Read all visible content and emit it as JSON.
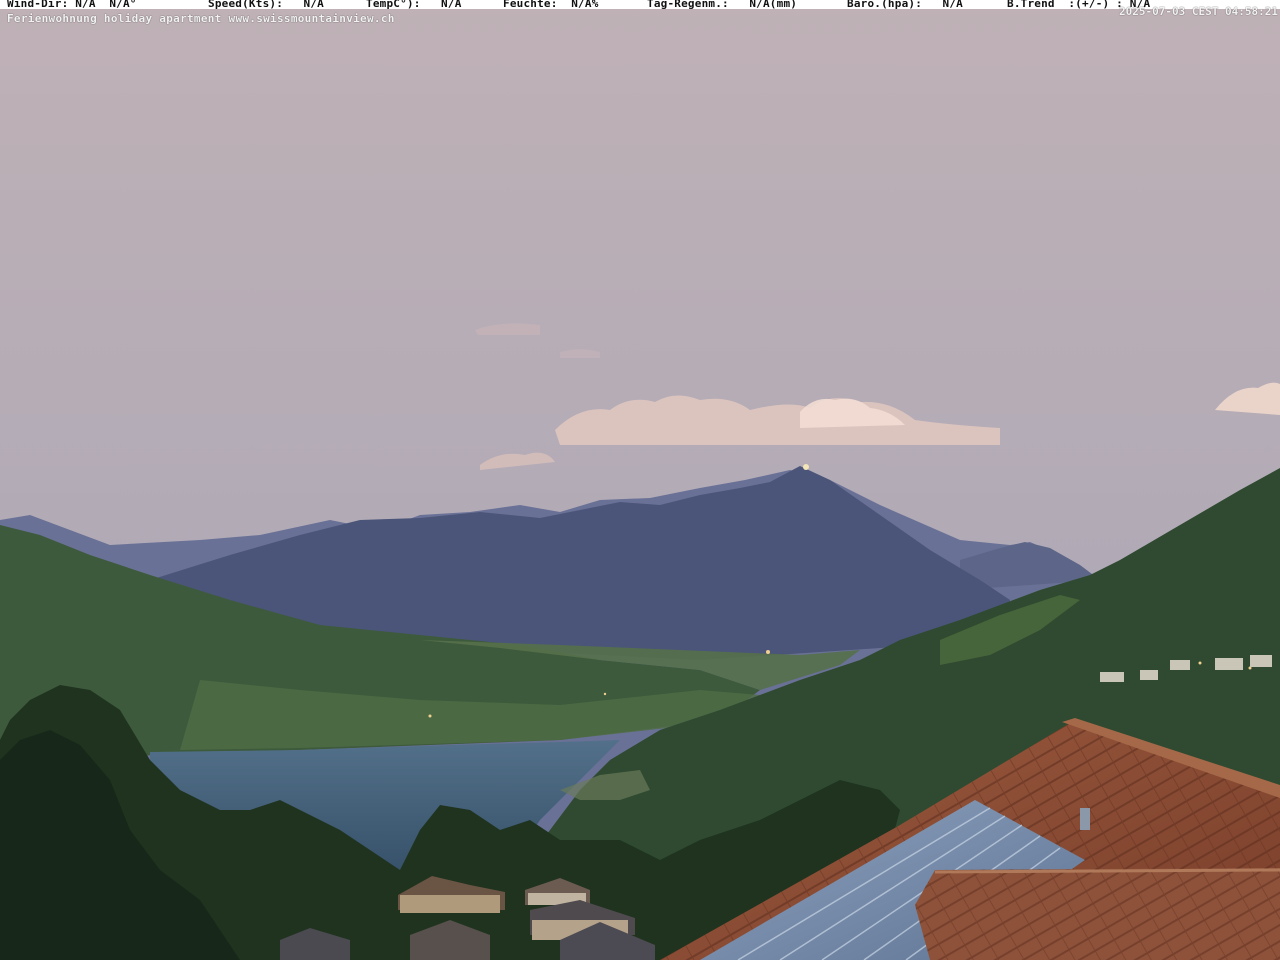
{
  "weather_bar": {
    "wind_dir": "Wind-Dir: N/A  N/A°",
    "speed": "Speed(Kts):   N/A",
    "temp": "TempC°):   N/A",
    "humidity": "Feuchte:  N/A%",
    "rain": "Tag-Regenm.:   N/A(mm)",
    "baro": "Baro.(hpa):   N/A",
    "trend": "B.Trend  :(+/-) : N/A"
  },
  "caption": "Ferienwohnung holiday apartment www.swissmountainview.ch",
  "timestamp": "2025-07-03 CEST 04:58:21",
  "colors": {
    "sky_top": "#c0b0b8",
    "sky_bottom": "#a8a8b8",
    "mountain_far": "#5a6488",
    "mountain_mid": "#3f4a6e",
    "slope_green": "#2f4a30",
    "lake": "#4a6680",
    "roof": "#8a4a32",
    "solar": "#7f93b0"
  },
  "scene": {
    "features": [
      "sky",
      "clouds",
      "mountain-range",
      "niesen-peak",
      "lake-thun",
      "left-slope",
      "right-slope",
      "village-houses",
      "tree-line",
      "tiled-roof",
      "solar-panels"
    ]
  }
}
